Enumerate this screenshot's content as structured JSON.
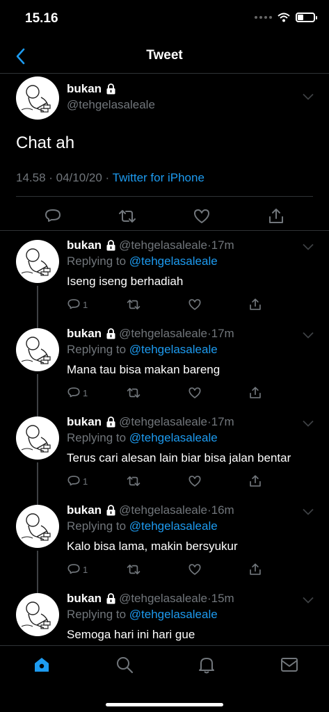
{
  "status_bar": {
    "time": "15.16",
    "battery_level": 0.35
  },
  "header": {
    "title": "Tweet",
    "back_icon": "chevron-left-icon"
  },
  "main_tweet": {
    "name": "bukan",
    "handle": "@tehgelasaleale",
    "text": "Chat ah",
    "timestamp": "14.58 · 04/10/20 · ",
    "source": "Twitter for iPhone",
    "actions": [
      "reply-icon",
      "retweet-icon",
      "like-icon",
      "share-icon"
    ]
  },
  "replies": [
    {
      "name": "bukan",
      "handle": "@tehgelasaleale",
      "time": "·17m",
      "replying_prefix": "Replying to ",
      "replying_to": "@tehgelasaleale",
      "text": "Iseng iseng berhadiah",
      "reply_count": "1"
    },
    {
      "name": "bukan",
      "handle": "@tehgelasaleale",
      "time": "·17m",
      "replying_prefix": "Replying to ",
      "replying_to": "@tehgelasaleale",
      "text": "Mana tau bisa makan bareng",
      "reply_count": "1"
    },
    {
      "name": "bukan",
      "handle": "@tehgelasaleale",
      "time": "·17m",
      "replying_prefix": "Replying to ",
      "replying_to": "@tehgelasaleale",
      "text": "Terus cari alesan lain biar bisa jalan bentar",
      "reply_count": "1"
    },
    {
      "name": "bukan",
      "handle": "@tehgelasaleale",
      "time": "·16m",
      "replying_prefix": "Replying to ",
      "replying_to": "@tehgelasaleale",
      "text": "Kalo bisa lama, makin bersyukur",
      "reply_count": "1"
    },
    {
      "name": "bukan",
      "handle": "@tehgelasaleale",
      "time": "·15m",
      "replying_prefix": "Replying to ",
      "replying_to": "@tehgelasaleale",
      "text": "Semoga hari ini hari gue",
      "reply_count": ""
    }
  ],
  "bottom_nav": {
    "items": [
      "home-icon",
      "search-icon",
      "notifications-icon",
      "messages-icon"
    ],
    "active": "home-icon"
  },
  "colors": {
    "background": "#000000",
    "accent": "#1d9bf0",
    "secondary_text": "#71767b",
    "divider": "#2f3336"
  }
}
